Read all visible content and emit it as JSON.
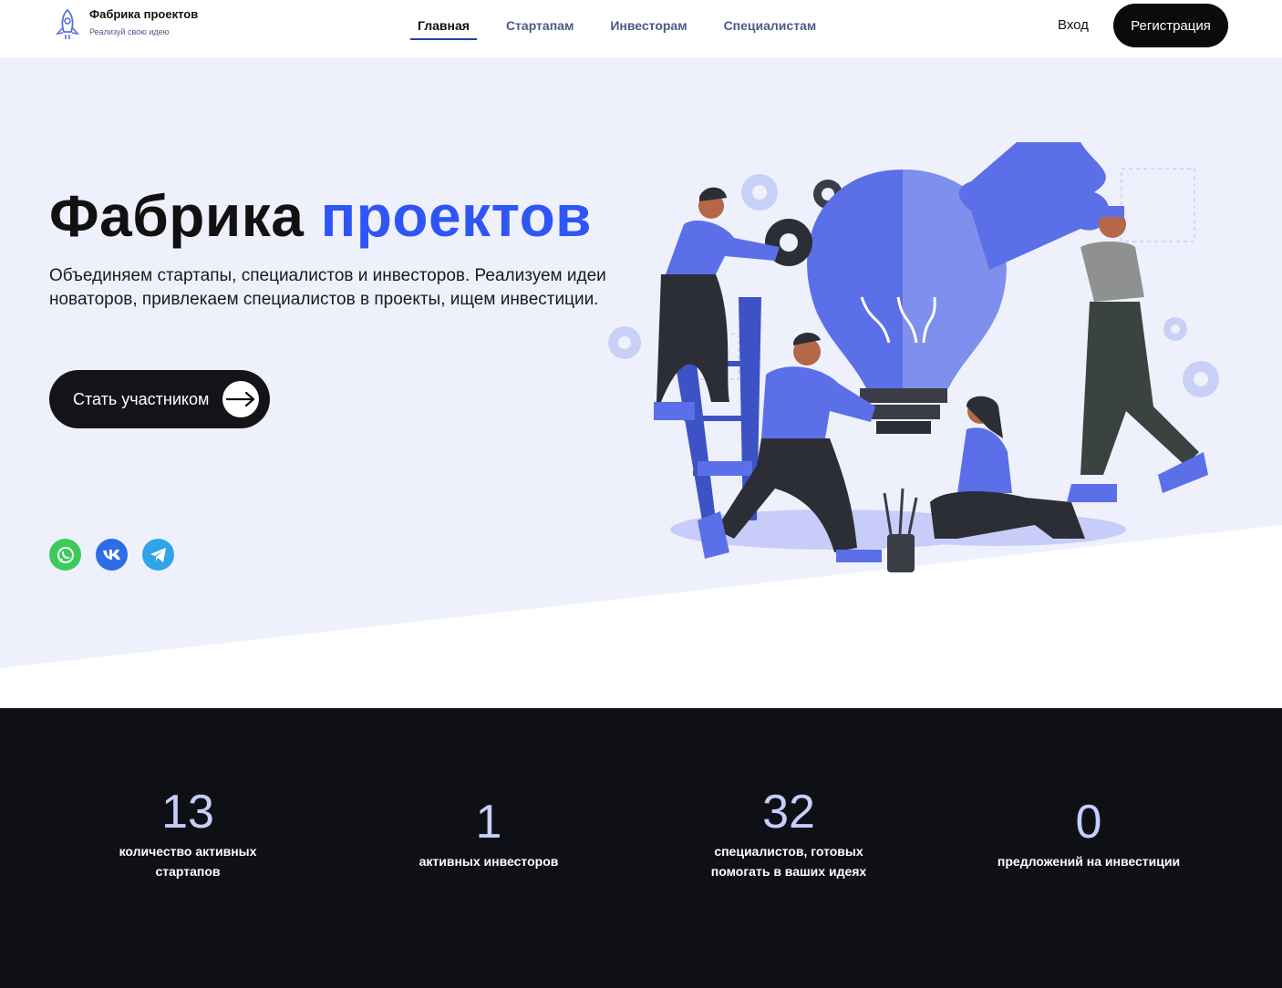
{
  "header": {
    "logo_title": "Фабрика проектов",
    "logo_subtitle": "Реализуй свою идею",
    "nav": [
      "Главная",
      "Стартапам",
      "Инвесторам",
      "Специалистам"
    ],
    "login": "Вход",
    "register": "Регистрация"
  },
  "hero": {
    "title_part1": "Фабрика",
    "title_part2": "проектов",
    "description": "Объединяем стартапы, специалистов и инвесторов. Реализуем идеи новаторов, привлекаем специалистов в проекты, ищем инвестиции.",
    "cta": "Стать участником",
    "socials": [
      "whatsapp-icon",
      "vk-icon",
      "telegram-icon"
    ]
  },
  "stats": [
    {
      "value": "13",
      "label": "количество активных стартапов"
    },
    {
      "value": "1",
      "label": "активных инвесторов"
    },
    {
      "value": "32",
      "label": "специалистов, готовых помогать в ваших идеях"
    },
    {
      "value": "0",
      "label": "предложений на инвестиции"
    }
  ],
  "colors": {
    "accent": "#2f55f5",
    "hero_bg": "#eef0fc",
    "stats_bg": "#0f1016",
    "stat_number": "#c6cffb"
  }
}
